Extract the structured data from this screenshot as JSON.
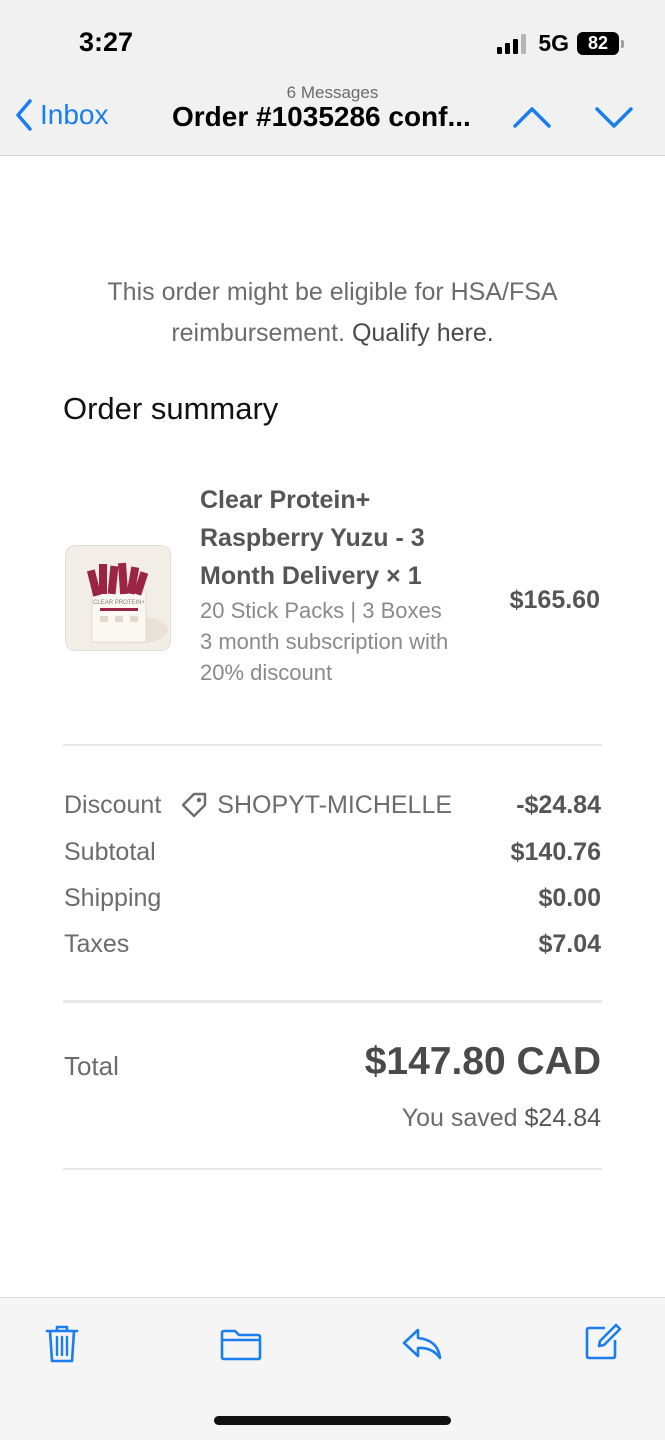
{
  "status_bar": {
    "time": "3:27",
    "network": "5G",
    "battery": "82"
  },
  "nav": {
    "back_label": "Inbox",
    "message_count": "6 Messages",
    "title": "Order #1035286 conf..."
  },
  "hsa_notice": {
    "text": "This order might be eligible for HSA/FSA reimbursement.",
    "link": "Qualify here."
  },
  "order_summary": {
    "title": "Order summary",
    "item": {
      "name": "Clear Protein+ Raspberry Yuzu - 3 Month Delivery × 1",
      "variant": "20 Stick Packs | 3 Boxes",
      "plan": "3 month subscription with 20% discount",
      "price": "$165.60",
      "thumb_text": "CLEAR PROTEIN+"
    }
  },
  "totals": {
    "discount_label": "Discount",
    "discount_code": "SHOPYT-MICHELLE",
    "discount_value": "-$24.84",
    "subtotal_label": "Subtotal",
    "subtotal_value": "$140.76",
    "shipping_label": "Shipping",
    "shipping_value": "$0.00",
    "taxes_label": "Taxes",
    "taxes_value": "$7.04",
    "total_label": "Total",
    "total_value": "$147.80 CAD",
    "saved_label": "You saved",
    "saved_value": "$24.84"
  },
  "colors": {
    "accent": "#1a7df0",
    "toolbar_bg": "#f5f5f5",
    "header_bg": "#f1f1f1"
  },
  "toolbar": {
    "icons": [
      "trash-icon",
      "folder-icon",
      "reply-icon",
      "compose-icon"
    ]
  }
}
